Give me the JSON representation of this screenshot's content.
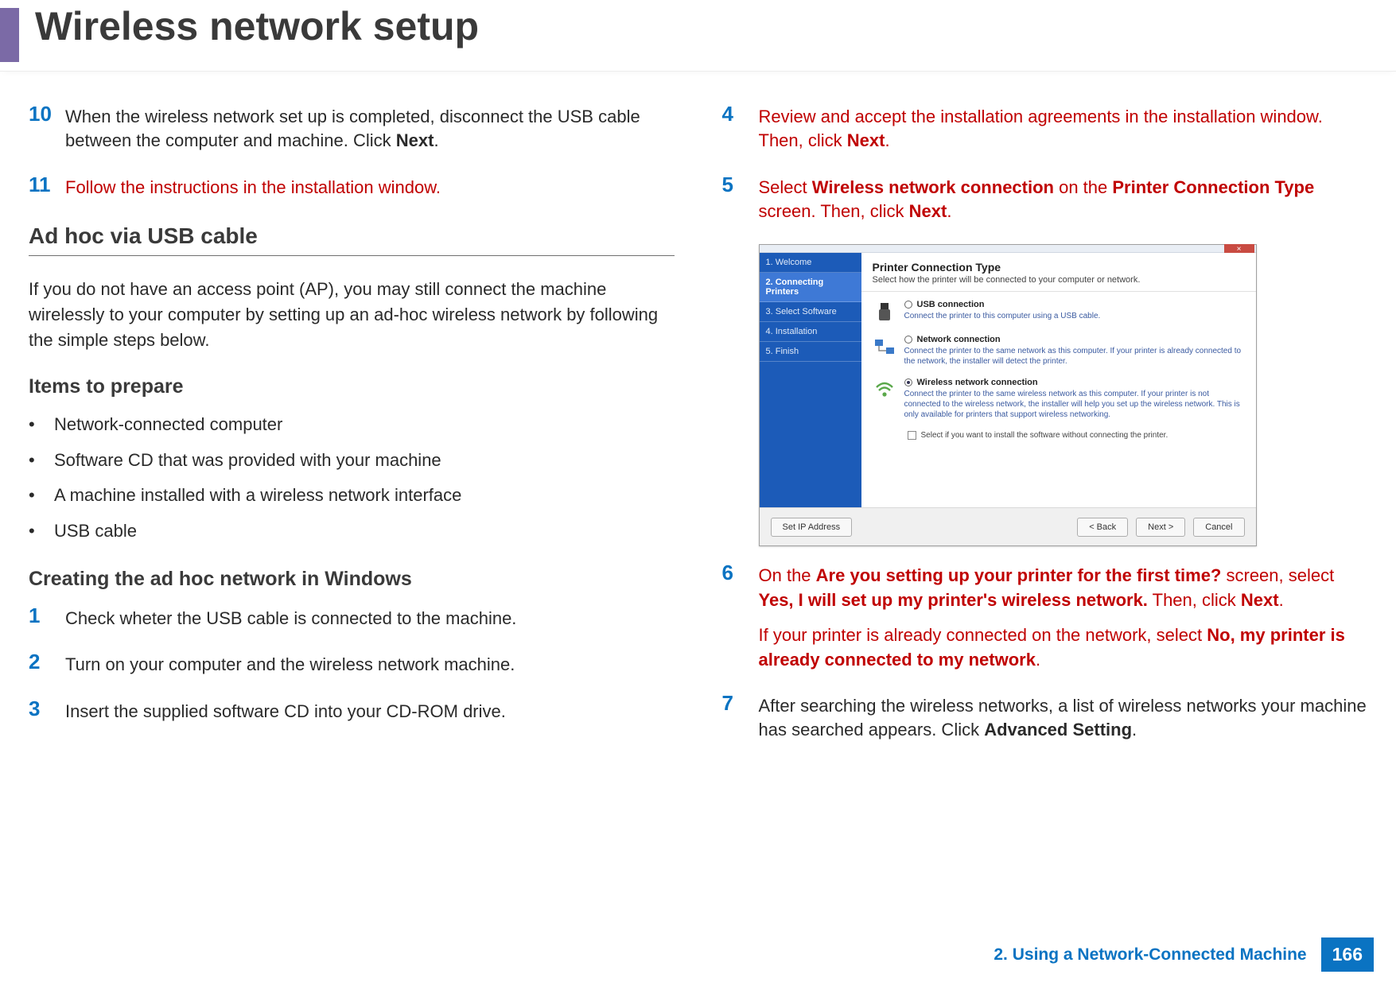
{
  "header": {
    "title": "Wireless network setup"
  },
  "left": {
    "step10": {
      "num": "10",
      "text_a": "When the wireless network set up is completed, disconnect the USB cable between the computer and machine. Click ",
      "bold_a": "Next",
      "text_b": "."
    },
    "step11": {
      "num": "11",
      "text": "Follow the instructions in the installation window."
    },
    "sectionH": "Ad hoc via USB cable",
    "intro": "If you do not have an access point (AP), you may still connect the machine wirelessly to your computer by setting up an ad-hoc wireless network by following the simple steps below.",
    "itemsH": "Items to prepare",
    "items": [
      "Network-connected computer",
      "Software CD that was provided with your machine",
      "A machine installed with a wireless network interface",
      "USB cable"
    ],
    "createH": "Creating the ad hoc network in Windows",
    "step1": {
      "num": "1",
      "text": "Check wheter the USB cable is connected to the machine."
    },
    "step2": {
      "num": "2",
      "text": "Turn on your computer and the wireless network machine."
    },
    "step3": {
      "num": "3",
      "text": "Insert the supplied software CD into your CD-ROM drive."
    }
  },
  "right": {
    "step4": {
      "num": "4",
      "text_a": "Review and accept the installation agreements in the installation window. Then, click ",
      "bold_a": "Next",
      "text_b": "."
    },
    "step5": {
      "num": "5",
      "text_a": "Select ",
      "bold_a": "Wireless network connection",
      "text_b": " on the ",
      "bold_b": "Printer Connection Type",
      "text_c": " screen. Then, click ",
      "bold_c": "Next",
      "text_d": "."
    },
    "step6": {
      "num": "6",
      "p1_a": "On the ",
      "p1_bold_a": "Are you setting up your printer for the first time?",
      "p1_b": " screen, select ",
      "p1_bold_b": "Yes, I will set up my printer's wireless network.",
      "p1_c": " Then, click ",
      "p1_bold_c": "Next",
      "p1_d": ".",
      "p2_a": "If your printer is already connected on the network, select ",
      "p2_bold_a": "No, my printer is already connected to my network",
      "p2_b": "."
    },
    "step7": {
      "num": "7",
      "text_a": "After searching the wireless networks, a list of wireless networks your machine has searched appears. Click ",
      "bold_a": "Advanced Setting",
      "text_b": "."
    }
  },
  "dialog": {
    "title_close": "×",
    "side": [
      "1. Welcome",
      "2. Connecting Printers",
      "3. Select Software",
      "4. Installation",
      "5. Finish"
    ],
    "heading": "Printer Connection Type",
    "sub": "Select how the printer will be connected to your computer or network.",
    "opt_usb": {
      "title": "USB connection",
      "desc": "Connect the printer to this computer using a USB cable."
    },
    "opt_net": {
      "title": "Network connection",
      "desc": "Connect the printer to the same network as this computer.\nIf your printer is already connected to the network, the installer will detect the printer."
    },
    "opt_wifi": {
      "title": "Wireless network connection",
      "desc": "Connect the printer to the same wireless network as this computer.\nIf your printer is not connected to the wireless network, the installer will help you set up the wireless network. This is only available for printers that support wireless networking."
    },
    "checkbox": "Select if you want to install the software without connecting the printer.",
    "btn_ip": "Set IP Address",
    "btn_back": "< Back",
    "btn_next": "Next >",
    "btn_cancel": "Cancel"
  },
  "footer": {
    "chapter": "2.  Using a Network-Connected Machine",
    "page": "166"
  }
}
